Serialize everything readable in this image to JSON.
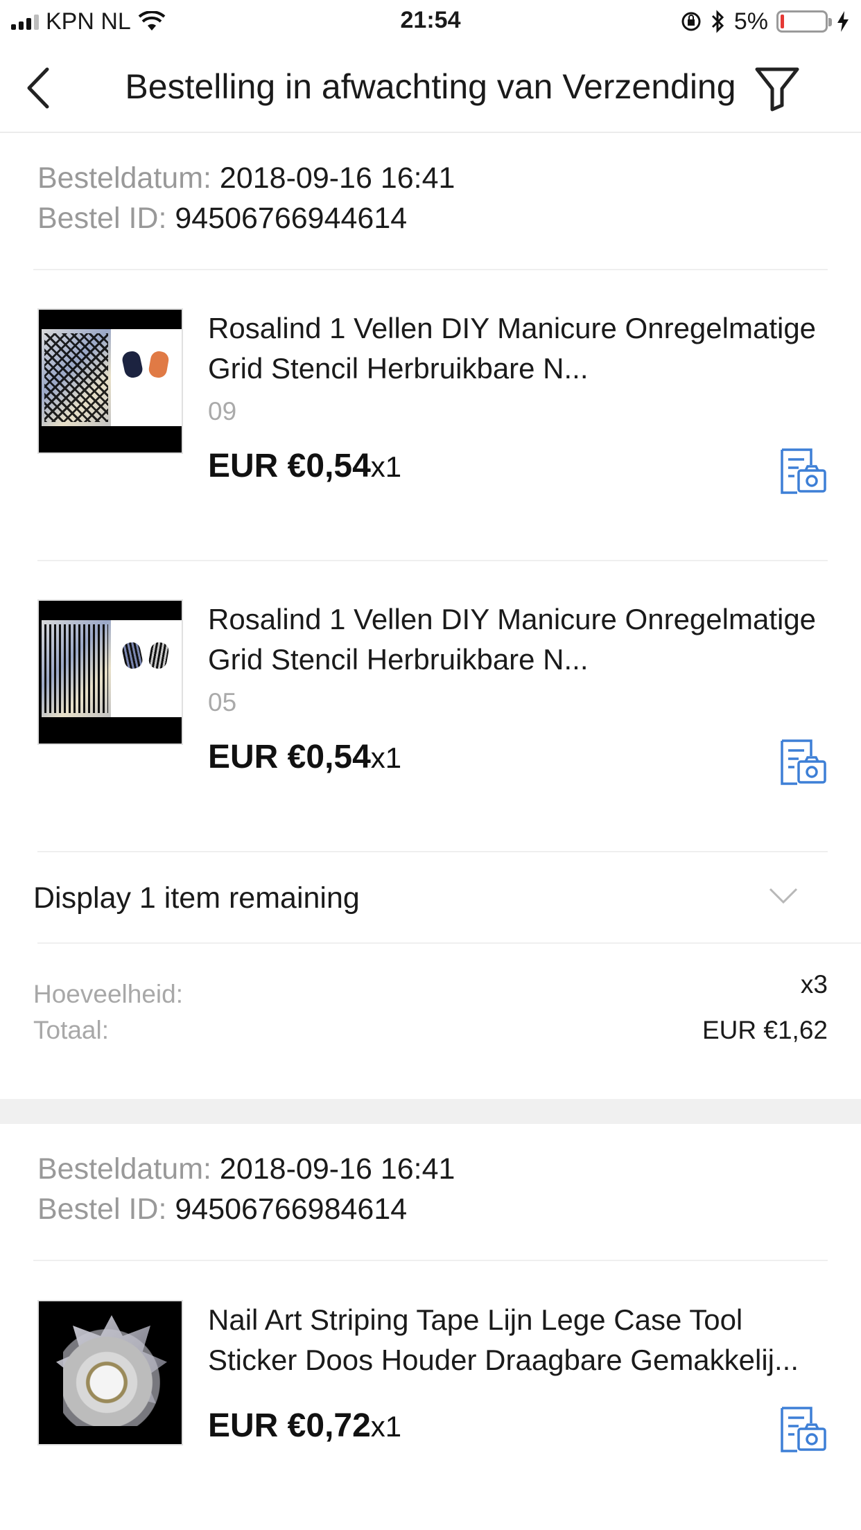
{
  "status_bar": {
    "carrier": "KPN NL",
    "time": "21:54",
    "battery": "5%"
  },
  "nav": {
    "title": "Bestelling in afwachting van Verzending"
  },
  "orders": [
    {
      "date_label": "Besteldatum:",
      "date": "2018-09-16 16:41",
      "id_label": "Bestel ID:",
      "id": "94506766944614",
      "items": [
        {
          "name": "Rosalind 1 Vellen DIY Manicure Onregelmatige Grid Stencil Herbruikbare N...",
          "variant": "09",
          "price": "EUR €0,54",
          "qty": "x1",
          "thumb_code": "JVL0030"
        },
        {
          "name": "Rosalind 1 Vellen DIY Manicure Onregelmatige Grid Stencil Herbruikbare N...",
          "variant": "05",
          "price": "EUR €0,54",
          "qty": "x1",
          "thumb_code": "JVL008"
        }
      ],
      "expand_label": "Display 1 item remaining",
      "quantity_label": "Hoeveelheid:",
      "quantity": "x3",
      "total_label": "Totaal:",
      "total": "EUR €1,62"
    },
    {
      "date_label": "Besteldatum:",
      "date": "2018-09-16 16:41",
      "id_label": "Bestel ID:",
      "id": "94506766984614",
      "items": [
        {
          "name": "Nail Art Striping Tape Lijn Lege Case Tool Sticker Doos Houder Draagbare Gemakkelij...",
          "price": "EUR €0,72",
          "qty": "x1"
        }
      ]
    }
  ],
  "colors": {
    "accent_icon": "#3d7fd6",
    "label_gray": "#999999",
    "divider": "#efefef"
  }
}
